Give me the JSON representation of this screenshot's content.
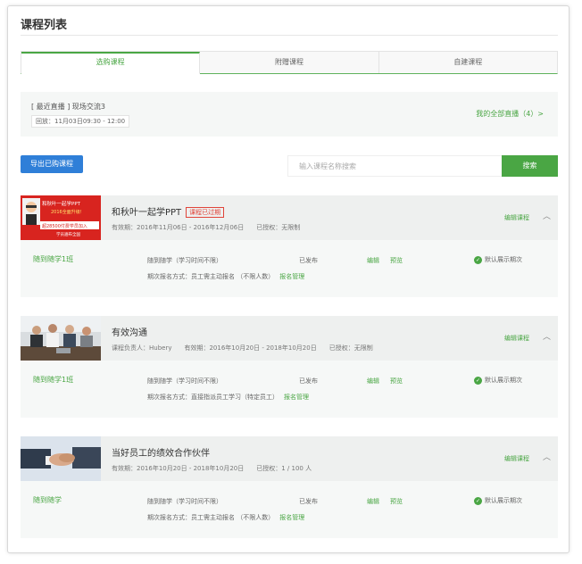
{
  "page": {
    "title": "课程列表"
  },
  "tabs": [
    {
      "label": "选购课程",
      "active": true
    },
    {
      "label": "附赠课程",
      "active": false
    },
    {
      "label": "自建课程",
      "active": false
    }
  ],
  "live": {
    "title": "[ 最近直播 ] 现场交流3",
    "time": "回放：11月03日09:30 - 12:00",
    "all_link": "我的全部直播（4）>"
  },
  "toolbar": {
    "export_label": "导出已购课程",
    "search_placeholder": "输入课程名称搜索",
    "search_label": "搜索"
  },
  "courses": [
    {
      "title": "和秋叶一起学PPT",
      "badge": "课程已过期",
      "meta": "有效期：2016年11月06日 - 2016年12月06日　　已授权：无限制",
      "edit": "编辑课程",
      "thumb": {
        "brand": "和秋叶一起学PPT",
        "line1": "2016全面升级!",
        "line2": "超28500付费学员加入",
        "line3": "学员遍布全国"
      },
      "row": {
        "name": "随到随学1班",
        "mode": "随到随学（学习时间不限）",
        "status": "已发布",
        "edit": "编辑",
        "preview": "预览",
        "default": "默认展示期次",
        "signup": "期次报名方式：员工需主动报名 （不限人数）",
        "signup_link": "报名管理"
      }
    },
    {
      "title": "有效沟通",
      "badge": "",
      "meta": "课程负责人：Hubery　　有效期：2016年10月20日 - 2018年10月20日　　已授权：无限制",
      "edit": "编辑课程",
      "row": {
        "name": "随到随学1班",
        "mode": "随到随学（学习时间不限）",
        "status": "已发布",
        "edit": "编辑",
        "preview": "预览",
        "default": "默认展示期次",
        "signup": "期次报名方式：直接指派员工学习（特定员工）",
        "signup_link": "报名管理"
      }
    },
    {
      "title": "当好员工的绩效合作伙伴",
      "badge": "",
      "meta": "有效期：2016年10月20日 - 2018年10月20日　　已授权：1 / 100 人",
      "edit": "编辑课程",
      "row": {
        "name": "随到随学",
        "mode": "随到随学（学习时间不限）",
        "status": "已发布",
        "edit": "编辑",
        "preview": "预览",
        "default": "默认展示期次",
        "signup": "期次报名方式：员工需主动报名 （不限人数）",
        "signup_link": "报名管理"
      }
    }
  ],
  "icons": {
    "chevron": "chevron-up-icon",
    "default_dot": "check-circle-icon"
  },
  "colors": {
    "accent": "#4aa644",
    "primary": "#2f7fd8",
    "danger": "#e0453a"
  }
}
